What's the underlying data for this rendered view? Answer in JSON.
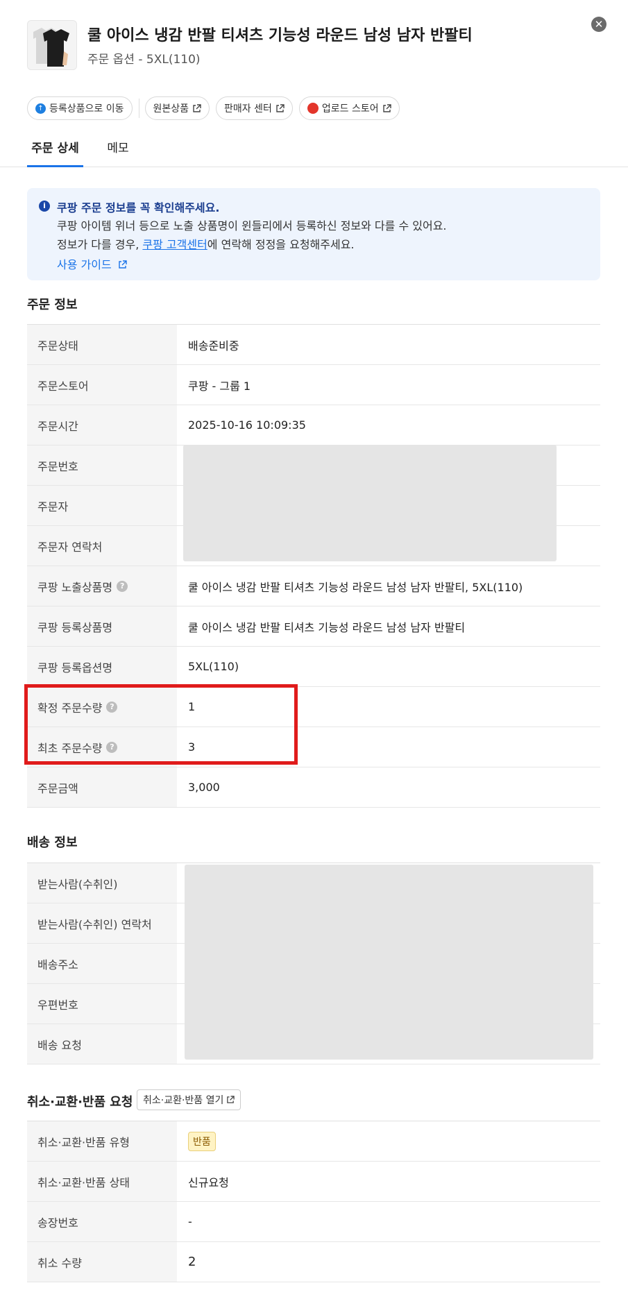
{
  "header": {
    "title": "쿨 아이스 냉감 반팔 티셔츠 기능성 라운드 남성 남자 반팔티",
    "subtitle": "주문 옵션 - 5XL(110)",
    "close_icon": "close-icon"
  },
  "chips": [
    {
      "label": "등록상품으로 이동",
      "icon": "arrow-up-circle-icon"
    },
    {
      "label": "원본상품",
      "icon": "external-link-icon"
    },
    {
      "label": "판매자 센터",
      "icon": "external-link-icon"
    },
    {
      "label": "업로드 스토어",
      "icon": "external-link-icon",
      "logo_text": "coupang"
    }
  ],
  "tabs": [
    {
      "label": "주문 상세",
      "active": true
    },
    {
      "label": "메모",
      "active": false
    }
  ],
  "notice": {
    "title": "쿠팡 주문 정보를 꼭 확인해주세요.",
    "line1": "쿠팡 아이템 위너 등으로 노출 상품명이 윈들리에서 등록하신 정보와 다를 수 있어요.",
    "line2_prefix": "정보가 다를 경우, ",
    "line2_link": "쿠팡 고객센터",
    "line2_suffix": "에 연락해 정정을 요청해주세요.",
    "guide": "사용 가이드"
  },
  "order_info": {
    "title": "주문 정보",
    "rows": [
      {
        "label": "주문상태",
        "value": "배송준비중"
      },
      {
        "label": "주문스토어",
        "value": "쿠팡 - 그룹 1"
      },
      {
        "label": "주문시간",
        "value": "2025-10-16 10:09:35"
      },
      {
        "label": "주문번호",
        "value": ""
      },
      {
        "label": "주문자",
        "value": ""
      },
      {
        "label": "주문자 연락처",
        "value": ""
      },
      {
        "label": "쿠팡 노출상품명",
        "value": "쿨 아이스 냉감 반팔 티셔츠 기능성 라운드 남성 남자 반팔티, 5XL(110)",
        "help": true
      },
      {
        "label": "쿠팡 등록상품명",
        "value": "쿨 아이스 냉감 반팔 티셔츠 기능성 라운드 남성 남자 반팔티"
      },
      {
        "label": "쿠팡 등록옵션명",
        "value": "5XL(110)"
      },
      {
        "label": "확정 주문수량",
        "value": "1",
        "help": true
      },
      {
        "label": "최초 주문수량",
        "value": "3",
        "help": true
      },
      {
        "label": "주문금액",
        "value": "3,000"
      }
    ]
  },
  "shipping_info": {
    "title": "배송 정보",
    "rows": [
      {
        "label": "받는사람(수취인)",
        "value": ""
      },
      {
        "label": "받는사람(수취인) 연락처",
        "value": ""
      },
      {
        "label": "배송주소",
        "value": ""
      },
      {
        "label": "우편번호",
        "value": ""
      },
      {
        "label": "배송 요청",
        "value": ""
      }
    ]
  },
  "claim_info": {
    "title": "취소·교환·반품 요청",
    "open_button": "취소·교환·반품 열기",
    "rows": [
      {
        "label": "취소·교환·반품 유형",
        "value": "반품",
        "badge": true
      },
      {
        "label": "취소·교환·반품 상태",
        "value": "신규요청"
      },
      {
        "label": "송장번호",
        "value": "-"
      },
      {
        "label": "취소 수량",
        "value": "2"
      }
    ]
  },
  "colors": {
    "accent": "#1a73e8",
    "highlight": "#e01b1b",
    "notice_bg": "#eef4fd",
    "badge_bg": "#fff3c4"
  }
}
